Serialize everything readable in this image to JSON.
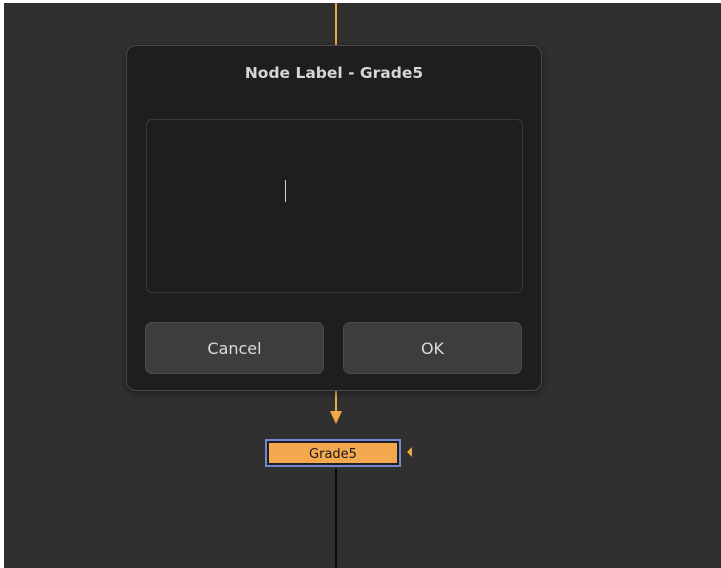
{
  "dialog": {
    "title": "Node Label - Grade5",
    "input_value": "",
    "cancel_label": "Cancel",
    "ok_label": "OK"
  },
  "node_graph": {
    "selected_node": {
      "label": "Grade5",
      "color": "#f4a850",
      "selected_border_color": "#7486d2"
    },
    "pipe_color": "#f0a848",
    "output_pipe_color": "#080808",
    "background_color": "#303030"
  }
}
